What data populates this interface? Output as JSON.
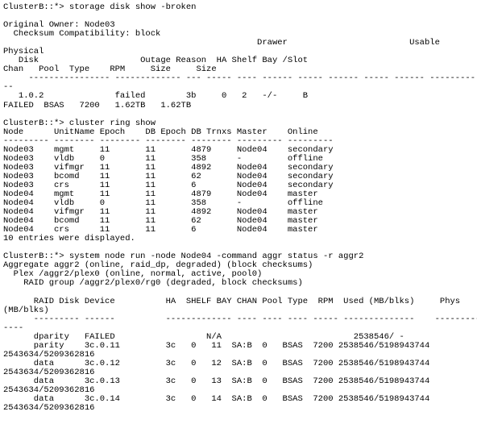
{
  "terminal": {
    "prompt": "ClusterB::*>",
    "lines": [
      "ClusterB::*> storage disk show -broken",
      "",
      "Original Owner: Node03",
      "  Checksum Compatibility: block",
      "                                                  Drawer                        Usable",
      "Physical",
      "   Disk                    Outage Reason  HA Shelf Bay /Slot",
      "Chan   Pool  Type    RPM     Size     Size",
      "     ---------------- ------------- --- ----- ---- ------ ----- ------ ----- ------ --------- ------",
      "--",
      "   1.0.2              failed        3b     0   2   -/-     B",
      "FAILED  BSAS   7200   1.62TB   1.62TB",
      "",
      "ClusterB::*> cluster ring show",
      "Node      UnitName Epoch    DB Epoch DB Trnxs Master    Online",
      "--------- -------- -------- -------- -------- --------- ---------",
      "Node03    mgmt     11       11       4879     Node04    secondary",
      "Node03    vldb     0        11       358      -         offline",
      "Node03    vifmgr   11       11       4892     Node04    secondary",
      "Node03    bcomd    11       11       62       Node04    secondary",
      "Node03    crs      11       11       6        Node04    secondary",
      "Node04    mgmt     11       11       4879     Node04    master",
      "Node04    vldb     0        11       358      -         offline",
      "Node04    vifmgr   11       11       4892     Node04    master",
      "Node04    bcomd    11       11       62       Node04    master",
      "Node04    crs      11       11       6        Node04    master",
      "10 entries were displayed.",
      "",
      "ClusterB::*> system node run -node Node04 -command aggr status -r aggr2",
      "Aggregate aggr2 (online, raid_dp, degraded) (block checksums)",
      "  Plex /aggr2/plex0 (online, normal, active, pool0)",
      "    RAID group /aggr2/plex0/rg0 (degraded, block checksums)",
      "",
      "      RAID Disk Device          HA  SHELF BAY CHAN Pool Type  RPM  Used (MB/blks)     Phys",
      "(MB/blks)",
      "      --------- ------          ------------- ---- ---- ---- ----- --------------    ---------",
      "----",
      "      dparity   FAILED                  N/A                          2538546/ -",
      "      parity    3c.0.11         3c   0   11  SA:B  0   BSAS  7200 2538546/5198943744",
      "2543634/5209362816",
      "      data      3c.0.12         3c   0   12  SA:B  0   BSAS  7200 2538546/5198943744",
      "2543634/5209362816",
      "      data      3c.0.13         3c   0   13  SA:B  0   BSAS  7200 2538546/5198943744",
      "2543634/5209362816",
      "      data      3c.0.14         3c   0   14  SA:B  0   BSAS  7200 2538546/5198943744",
      "2543634/5209362816"
    ],
    "commands": [
      "storage disk show -broken",
      "cluster ring show",
      "system node run -node Node04 -command aggr status -r aggr2"
    ],
    "disk_show": {
      "original_owner_label": "Original Owner:",
      "original_owner": "Node03",
      "checksum_label": "Checksum Compatibility:",
      "checksum": "block",
      "headers": [
        "Physical",
        "Disk",
        "Outage Reason",
        "HA",
        "Shelf",
        "Bay",
        "/Slot",
        "Drawer",
        "Usable",
        "Chan",
        "Pool",
        "Type",
        "RPM",
        "Size",
        "Size"
      ],
      "row": {
        "disk": "1.0.2",
        "outage_reason": "failed",
        "ha": "3b",
        "shelf": "0",
        "bay": "2",
        "slot": "-/-",
        "drawer": "B",
        "chan": "FAILED",
        "pool": "BSAS",
        "type": "7200",
        "rpm": "1.62TB",
        "size": "1.62TB"
      }
    },
    "ring_show": {
      "headers": [
        "Node",
        "UnitName",
        "Epoch",
        "DB Epoch",
        "DB Trnxs",
        "Master",
        "Online"
      ],
      "rows": [
        [
          "Node03",
          "mgmt",
          "11",
          "11",
          "4879",
          "Node04",
          "secondary"
        ],
        [
          "Node03",
          "vldb",
          "0",
          "11",
          "358",
          "-",
          "offline"
        ],
        [
          "Node03",
          "vifmgr",
          "11",
          "11",
          "4892",
          "Node04",
          "secondary"
        ],
        [
          "Node03",
          "bcomd",
          "11",
          "11",
          "62",
          "Node04",
          "secondary"
        ],
        [
          "Node03",
          "crs",
          "11",
          "11",
          "6",
          "Node04",
          "secondary"
        ],
        [
          "Node04",
          "mgmt",
          "11",
          "11",
          "4879",
          "Node04",
          "master"
        ],
        [
          "Node04",
          "vldb",
          "0",
          "11",
          "358",
          "-",
          "offline"
        ],
        [
          "Node04",
          "vifmgr",
          "11",
          "11",
          "4892",
          "Node04",
          "master"
        ],
        [
          "Node04",
          "bcomd",
          "11",
          "11",
          "62",
          "Node04",
          "master"
        ],
        [
          "Node04",
          "crs",
          "11",
          "11",
          "6",
          "Node04",
          "master"
        ]
      ],
      "footer": "10 entries were displayed."
    },
    "aggr_status": {
      "aggregate_line": "Aggregate aggr2 (online, raid_dp, degraded) (block checksums)",
      "plex_line": "Plex /aggr2/plex0 (online, normal, active, pool0)",
      "raid_group_line": "RAID group /aggr2/plex0/rg0 (degraded, block checksums)",
      "headers": [
        "RAID Disk",
        "Device",
        "HA",
        "SHELF",
        "BAY",
        "CHAN",
        "Pool",
        "Type",
        "RPM",
        "Used (MB/blks)",
        "Phys (MB/blks)"
      ],
      "rows": [
        [
          "dparity",
          "FAILED",
          "",
          "",
          "",
          "N/A",
          "",
          "",
          "",
          "2538546/ -",
          ""
        ],
        [
          "parity",
          "3c.0.11",
          "3c",
          "0",
          "11",
          "SA:B",
          "0",
          "BSAS",
          "7200",
          "2538546/5198943744",
          "2543634/5209362816"
        ],
        [
          "data",
          "3c.0.12",
          "3c",
          "0",
          "12",
          "SA:B",
          "0",
          "BSAS",
          "7200",
          "2538546/5198943744",
          "2543634/5209362816"
        ],
        [
          "data",
          "3c.0.13",
          "3c",
          "0",
          "13",
          "SA:B",
          "0",
          "BSAS",
          "7200",
          "2538546/5198943744",
          "2543634/5209362816"
        ],
        [
          "data",
          "3c.0.14",
          "3c",
          "0",
          "14",
          "SA:B",
          "0",
          "BSAS",
          "7200",
          "2538546/5198943744",
          "2543634/5209362816"
        ]
      ]
    },
    "colors": {
      "background": "#ffffff",
      "foreground": "#000000"
    }
  }
}
